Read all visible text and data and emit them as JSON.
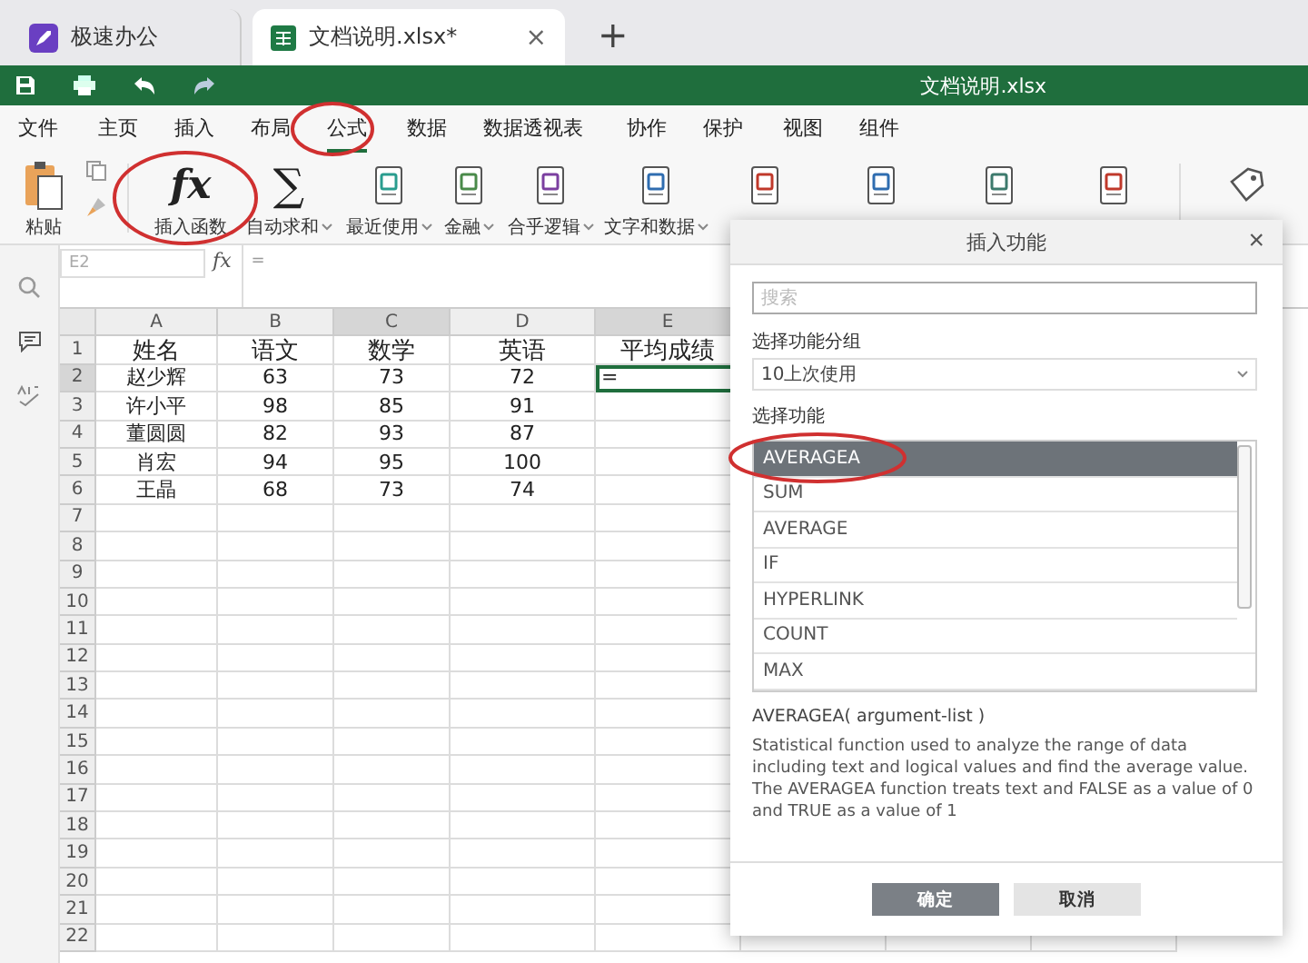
{
  "tabs": [
    {
      "label": "极速办公",
      "selected": false
    },
    {
      "label": "文档说明.xlsx*",
      "selected": true,
      "close": "×"
    }
  ],
  "new_tab_button": "+",
  "title_bar": {
    "title": "文档说明.xlsx"
  },
  "menu": [
    {
      "label": "文件",
      "selected": false
    },
    {
      "label": "主页",
      "selected": false
    },
    {
      "label": "插入",
      "selected": false
    },
    {
      "label": "布局",
      "selected": false
    },
    {
      "label": "公式",
      "selected": true
    },
    {
      "label": "数据",
      "selected": false
    },
    {
      "label": "数据透视表",
      "selected": false
    },
    {
      "label": "协作",
      "selected": false
    },
    {
      "label": "保护",
      "selected": false
    },
    {
      "label": "视图",
      "selected": false
    },
    {
      "label": "组件",
      "selected": false
    }
  ],
  "ribbon": [
    {
      "kind": "paste",
      "label": "粘贴"
    },
    {
      "kind": "small_stack"
    },
    {
      "kind": "glyph",
      "glyph": "fx",
      "label": "插入函数"
    },
    {
      "kind": "glyph",
      "glyph": "∑",
      "label": "自动求和",
      "dropdown": true
    },
    {
      "kind": "book",
      "label": "最近使用",
      "dropdown": true
    },
    {
      "kind": "book",
      "label": "金融",
      "dropdown": true
    },
    {
      "kind": "book",
      "label": "合乎逻辑",
      "dropdown": true
    },
    {
      "kind": "book",
      "label": "文字和数据",
      "dropdown": true
    },
    {
      "kind": "book"
    },
    {
      "kind": "book"
    },
    {
      "kind": "book"
    },
    {
      "kind": "book"
    },
    {
      "kind": "tag"
    }
  ],
  "formula_bar": {
    "cell_ref": "E2",
    "function_button": "fx",
    "value": "="
  },
  "sheet": {
    "columns": [
      {
        "label": "A",
        "selected": false
      },
      {
        "label": "B",
        "selected": false
      },
      {
        "label": "C",
        "selected": true
      },
      {
        "label": "D",
        "selected": false
      },
      {
        "label": "E",
        "selected": true
      }
    ],
    "rows": [
      {
        "label": "1",
        "selected": false,
        "header": true,
        "cells": [
          {
            "text": "姓名",
            "active": false
          },
          {
            "text": "语文",
            "active": false
          },
          {
            "text": "数学",
            "active": false
          },
          {
            "text": "英语",
            "active": false
          },
          {
            "text": "平均成绩",
            "active": false
          }
        ]
      },
      {
        "label": "2",
        "selected": true,
        "cells": [
          {
            "text": "赵少辉",
            "active": false
          },
          {
            "text": "63",
            "active": false
          },
          {
            "text": "73",
            "active": false
          },
          {
            "text": "72",
            "active": false
          },
          {
            "text": "=",
            "active": true
          }
        ]
      },
      {
        "label": "3",
        "selected": false,
        "cells": [
          {
            "text": "许小平",
            "active": false
          },
          {
            "text": "98",
            "active": false
          },
          {
            "text": "85",
            "active": false
          },
          {
            "text": "91",
            "active": false
          }
        ]
      },
      {
        "label": "4",
        "selected": false,
        "cells": [
          {
            "text": "董圆圆",
            "active": false
          },
          {
            "text": "82",
            "active": false
          },
          {
            "text": "93",
            "active": false
          },
          {
            "text": "87",
            "active": false
          }
        ]
      },
      {
        "label": "5",
        "selected": false,
        "cells": [
          {
            "text": "肖宏",
            "active": false
          },
          {
            "text": "94",
            "active": false
          },
          {
            "text": "95",
            "active": false
          },
          {
            "text": "100",
            "active": false
          }
        ]
      },
      {
        "label": "6",
        "selected": false,
        "cells": [
          {
            "text": "王晶",
            "active": false
          },
          {
            "text": "68",
            "active": false
          },
          {
            "text": "73",
            "active": false
          },
          {
            "text": "74",
            "active": false
          }
        ]
      },
      {
        "label": "7",
        "selected": false
      },
      {
        "label": "8",
        "selected": false
      },
      {
        "label": "9",
        "selected": false
      },
      {
        "label": "10",
        "selected": false
      },
      {
        "label": "11",
        "selected": false
      },
      {
        "label": "12",
        "selected": false
      },
      {
        "label": "13",
        "selected": false
      },
      {
        "label": "14",
        "selected": false
      },
      {
        "label": "15",
        "selected": false
      },
      {
        "label": "16",
        "selected": false
      },
      {
        "label": "17",
        "selected": false
      },
      {
        "label": "18",
        "selected": false
      },
      {
        "label": "19",
        "selected": false
      },
      {
        "label": "20",
        "selected": false
      },
      {
        "label": "21",
        "selected": false
      },
      {
        "label": "22",
        "selected": false
      }
    ]
  },
  "dialog": {
    "title": "插入功能",
    "close": "×",
    "search": {
      "placeholder": "搜索"
    },
    "group_label": "选择功能分组",
    "group_value": "10上次使用",
    "function_label": "选择功能",
    "functions": [
      {
        "name": "AVERAGEA",
        "selected": true
      },
      {
        "name": "SUM",
        "selected": false
      },
      {
        "name": "AVERAGE",
        "selected": false
      },
      {
        "name": "IF",
        "selected": false
      },
      {
        "name": "HYPERLINK",
        "selected": false
      },
      {
        "name": "COUNT",
        "selected": false
      },
      {
        "name": "MAX",
        "selected": false
      }
    ],
    "signature": "AVERAGEA( argument-list )",
    "description": "Statistical function used to analyze the range of data including text and logical values and find the average value. The AVERAGEA function treats text and FALSE as a value of 0 and TRUE as a value of 1",
    "buttons": [
      {
        "label": "确定",
        "kind": "primary"
      },
      {
        "label": "取消",
        "kind": "secondary"
      }
    ]
  }
}
